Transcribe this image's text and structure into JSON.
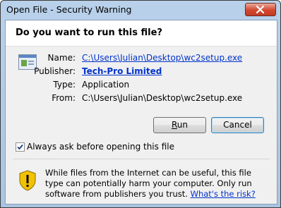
{
  "window": {
    "title": "Open File - Security Warning"
  },
  "dialog": {
    "question": "Do you want to run this file?",
    "fields": [
      {
        "label": "Name:",
        "value": "C:\\Users\\Julian\\Desktop\\wc2setup.exe",
        "link": true
      },
      {
        "label": "Publisher:",
        "value": "Tech-Pro Limited",
        "link": true
      },
      {
        "label": "Type:",
        "value": "Application",
        "link": false
      },
      {
        "label": "From:",
        "value": "C:\\Users\\Julian\\Desktop\\wc2setup.exe",
        "link": false
      }
    ],
    "run_button": "Run",
    "run_mnemonic": "R",
    "cancel_button": "Cancel",
    "checkbox": {
      "label": "Always ask before opening this file",
      "checked": true
    },
    "warning": {
      "text": "While files from the Internet can be useful, this file type can potentially harm your computer. Only run software from publishers you trust.",
      "link": "What's the risk?"
    }
  },
  "icons": [
    "close-icon",
    "application-icon",
    "checkmark-icon",
    "shield-warning-icon"
  ],
  "colors": {
    "link": "#0033cc",
    "close": "#c23a23",
    "shield_yellow": "#f2c200"
  }
}
